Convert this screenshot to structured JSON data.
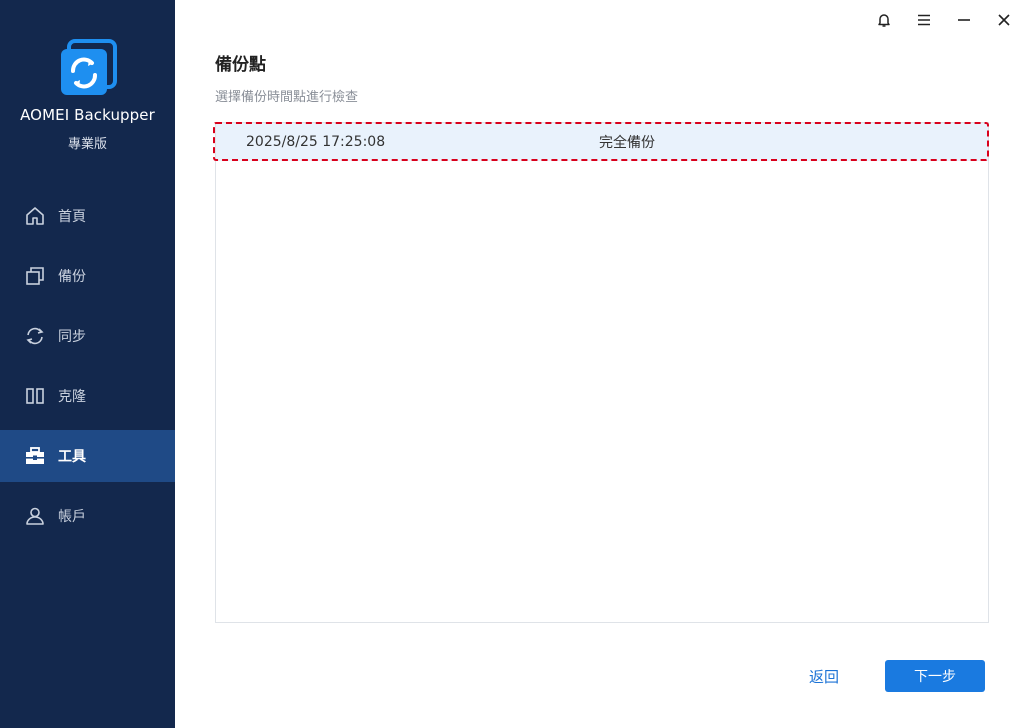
{
  "app": {
    "name": "AOMEI Backupper",
    "edition": "專業版"
  },
  "sidebar": {
    "items": [
      {
        "label": "首頁",
        "icon": "home-icon",
        "active": false
      },
      {
        "label": "備份",
        "icon": "backup-icon",
        "active": false
      },
      {
        "label": "同步",
        "icon": "sync-icon",
        "active": false
      },
      {
        "label": "克隆",
        "icon": "clone-icon",
        "active": false
      },
      {
        "label": "工具",
        "icon": "toolbox-icon",
        "active": true
      },
      {
        "label": "帳戶",
        "icon": "user-icon",
        "active": false
      }
    ]
  },
  "titlebar": {
    "icons": [
      "bell-icon",
      "menu-icon",
      "minimize-icon",
      "close-icon"
    ]
  },
  "main": {
    "title": "備份點",
    "subtitle": "選擇備份時間點進行檢查",
    "rows": [
      {
        "time": "2025/8/25 17:25:08",
        "type": "完全備份",
        "selected": true
      }
    ]
  },
  "footer": {
    "back_label": "返回",
    "next_label": "下一步"
  },
  "colors": {
    "sidebar_bg": "#13284d",
    "sidebar_active": "#1f4a86",
    "accent": "#1a7ae0",
    "row_selected": "#e9f2fc",
    "annotation": "#d9001b"
  }
}
